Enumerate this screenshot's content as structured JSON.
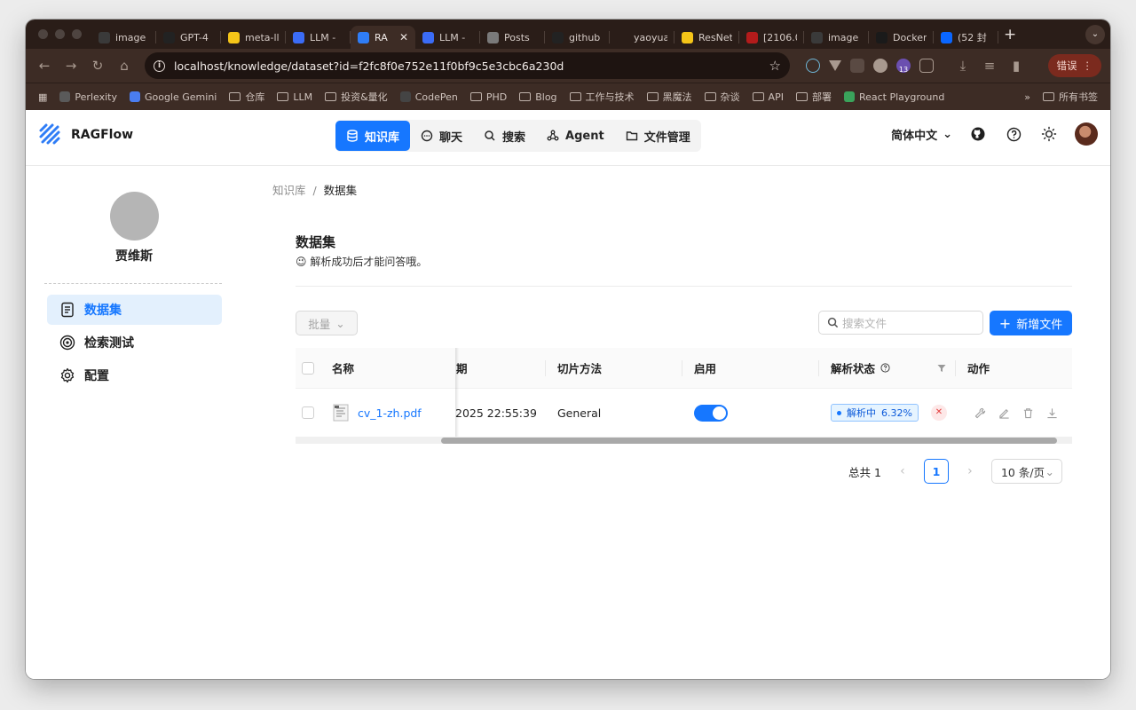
{
  "browser": {
    "tabs": [
      {
        "title": "image",
        "color": "#3a3a3a"
      },
      {
        "title": "GPT-4",
        "color": "#222222"
      },
      {
        "title": "meta-ll",
        "color": "#f5c518"
      },
      {
        "title": "LLM - ",
        "color": "#3b6cf6"
      },
      {
        "title": "RA",
        "color": "#2f7df6"
      },
      {
        "title": "LLM - ",
        "color": "#3b6cf6"
      },
      {
        "title": "Posts",
        "color": "#7a7a7a"
      },
      {
        "title": "github",
        "color": "#222222"
      },
      {
        "title": "yaoyua",
        "color": "#2a1d18"
      },
      {
        "title": "ResNet",
        "color": "#f5c518"
      },
      {
        "title": "[2106.0",
        "color": "#b31b1b"
      },
      {
        "title": "image",
        "color": "#3a3a3a"
      },
      {
        "title": "Docker",
        "color": "#1a1a1a"
      },
      {
        "title": "(52 封",
        "color": "#0a66ff"
      }
    ],
    "url": "localhost/knowledge/dataset?id=f2fc8f0e752e11f0bf9c5e3cbc6a230d",
    "error_label": "错误",
    "ext_badge": "13",
    "bookmarks": [
      "Perlexity",
      "Google Gemini",
      "仓库",
      "LLM",
      "投资&量化",
      "CodePen",
      "PHD",
      "Blog",
      "工作与技术",
      "黑魔法",
      "杂谈",
      "API",
      "部署",
      "React Playground"
    ],
    "all_bookmarks_label": "所有书签"
  },
  "app": {
    "brand": "RAGFlow",
    "nav": [
      "知识库",
      "聊天",
      "搜索",
      "Agent",
      "文件管理"
    ],
    "language": "简体中文"
  },
  "sidebar": {
    "user_name": "贾维斯",
    "menu": [
      "数据集",
      "检索测试",
      "配置"
    ]
  },
  "main": {
    "breadcrumb": {
      "parent": "知识库",
      "current": "数据集"
    },
    "title": "数据集",
    "subtitle": "解析成功后才能问答哦。",
    "subtitle_emoji": "😉",
    "batch_label": "批量",
    "search_placeholder": "搜索文件",
    "add_file_label": "新增文件"
  },
  "table": {
    "columns": [
      "名称",
      "期",
      "切片方法",
      "启用",
      "解析状态",
      "动作"
    ],
    "rows": [
      {
        "name": "cv_1-zh.pdf",
        "date": "2025 22:55:39",
        "chunk_method": "General",
        "enabled": true,
        "status_label": "解析中",
        "progress": "6.32%"
      }
    ]
  },
  "pagination": {
    "total_label": "总共 1",
    "current_page": "1",
    "page_size": "10 条/页"
  }
}
